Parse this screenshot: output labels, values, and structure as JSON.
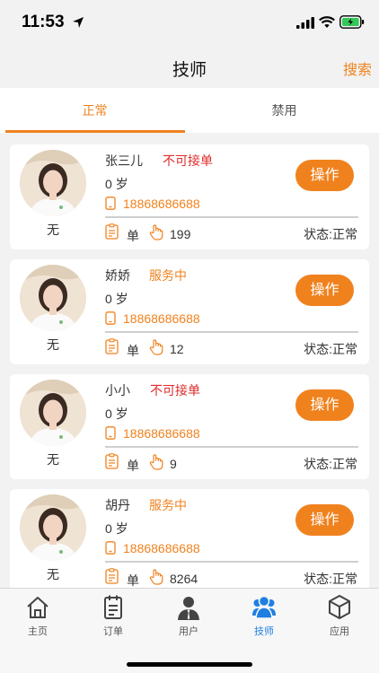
{
  "status_bar": {
    "time": "11:53"
  },
  "nav": {
    "title": "技师",
    "search_label": "搜索"
  },
  "tabs": [
    {
      "label": "正常",
      "active": true
    },
    {
      "label": "禁用",
      "active": false
    }
  ],
  "technicians": [
    {
      "name": "张三儿",
      "status": "不可接单",
      "status_color": "#e02b2b",
      "avatar_caption": "无",
      "age": "0 岁",
      "phone": "18868686688",
      "order_label": "单",
      "count": "199",
      "state": "状态:正常",
      "action": "操作"
    },
    {
      "name": "娇娇",
      "status": "服务中",
      "status_color": "#f0821e",
      "avatar_caption": "无",
      "age": "0 岁",
      "phone": "18868686688",
      "order_label": "单",
      "count": "12",
      "state": "状态:正常",
      "action": "操作"
    },
    {
      "name": "小小",
      "status": "不可接单",
      "status_color": "#e02b2b",
      "avatar_caption": "无",
      "age": "0 岁",
      "phone": "18868686688",
      "order_label": "单",
      "count": "9",
      "state": "状态:正常",
      "action": "操作"
    },
    {
      "name": "胡丹",
      "status": "服务中",
      "status_color": "#f0821e",
      "avatar_caption": "无",
      "age": "0 岁",
      "phone": "18868686688",
      "order_label": "单",
      "count": "8264",
      "state": "状态:正常",
      "action": "操作"
    }
  ],
  "tabbar": [
    {
      "label": "主页",
      "icon": "home-icon",
      "active": false
    },
    {
      "label": "订单",
      "icon": "order-icon",
      "active": false
    },
    {
      "label": "用户",
      "icon": "user-icon",
      "active": false
    },
    {
      "label": "技师",
      "icon": "technician-icon",
      "active": true
    },
    {
      "label": "应用",
      "icon": "app-cube-icon",
      "active": false
    }
  ],
  "colors": {
    "accent": "#f0821e",
    "unavailable": "#e02b2b",
    "tabbar_active": "#1f7fe0"
  }
}
